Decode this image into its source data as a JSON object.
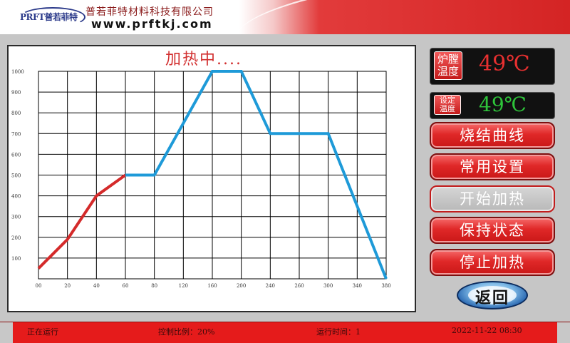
{
  "header": {
    "logo_text": "PRFT普若菲特",
    "company_name": "普若菲特材料科技有限公司",
    "website": "www.prftkj.com"
  },
  "chart_data": {
    "type": "line",
    "title": "加热中....",
    "xlabel": "",
    "ylabel": "",
    "x_ticks": [
      "00",
      "20",
      "40",
      "60",
      "80",
      "120",
      "160",
      "200",
      "240",
      "260",
      "300",
      "340",
      "380"
    ],
    "y_ticks": [
      "100",
      "200",
      "300",
      "400",
      "500",
      "600",
      "700",
      "800",
      "900",
      "1000"
    ],
    "ylim": [
      0,
      1000
    ],
    "grid": true,
    "series": [
      {
        "color": "#d42a2a",
        "points": [
          [
            0,
            50
          ],
          [
            1,
            190
          ],
          [
            2,
            400
          ],
          [
            3,
            500
          ]
        ]
      },
      {
        "color": "#1e9ad8",
        "points": [
          [
            3,
            500
          ],
          [
            4,
            500
          ],
          [
            5,
            750
          ],
          [
            6,
            1000
          ],
          [
            7,
            1000
          ],
          [
            8,
            700
          ],
          [
            9,
            700
          ],
          [
            10,
            700
          ],
          [
            11,
            350
          ],
          [
            12,
            0
          ]
        ]
      }
    ]
  },
  "readouts": {
    "furnace_label": "炉膛温度",
    "furnace_label_line1": "炉膛",
    "furnace_label_line2": "温度",
    "furnace_value": "49℃",
    "setpoint_label_line1": "设定",
    "setpoint_label_line2": "温度",
    "setpoint_value": "49℃"
  },
  "buttons": {
    "sinter_curve": "烧结曲线",
    "common_settings": "常用设置",
    "start_heating": "开始加热",
    "hold_status": "保持状态",
    "stop_heating": "停止加热",
    "back": "返回"
  },
  "status_bar": {
    "state": "正在运行",
    "control_ratio": "控制比例：20%",
    "run_time": "运行时间：1",
    "datetime": "2022-11-22 08:30"
  },
  "colors": {
    "accent_red": "#e02828",
    "heated_line": "#d42a2a",
    "pending_line": "#1e9ad8",
    "furnace_temp": "#e83030",
    "setpoint_temp": "#2ec43a"
  }
}
